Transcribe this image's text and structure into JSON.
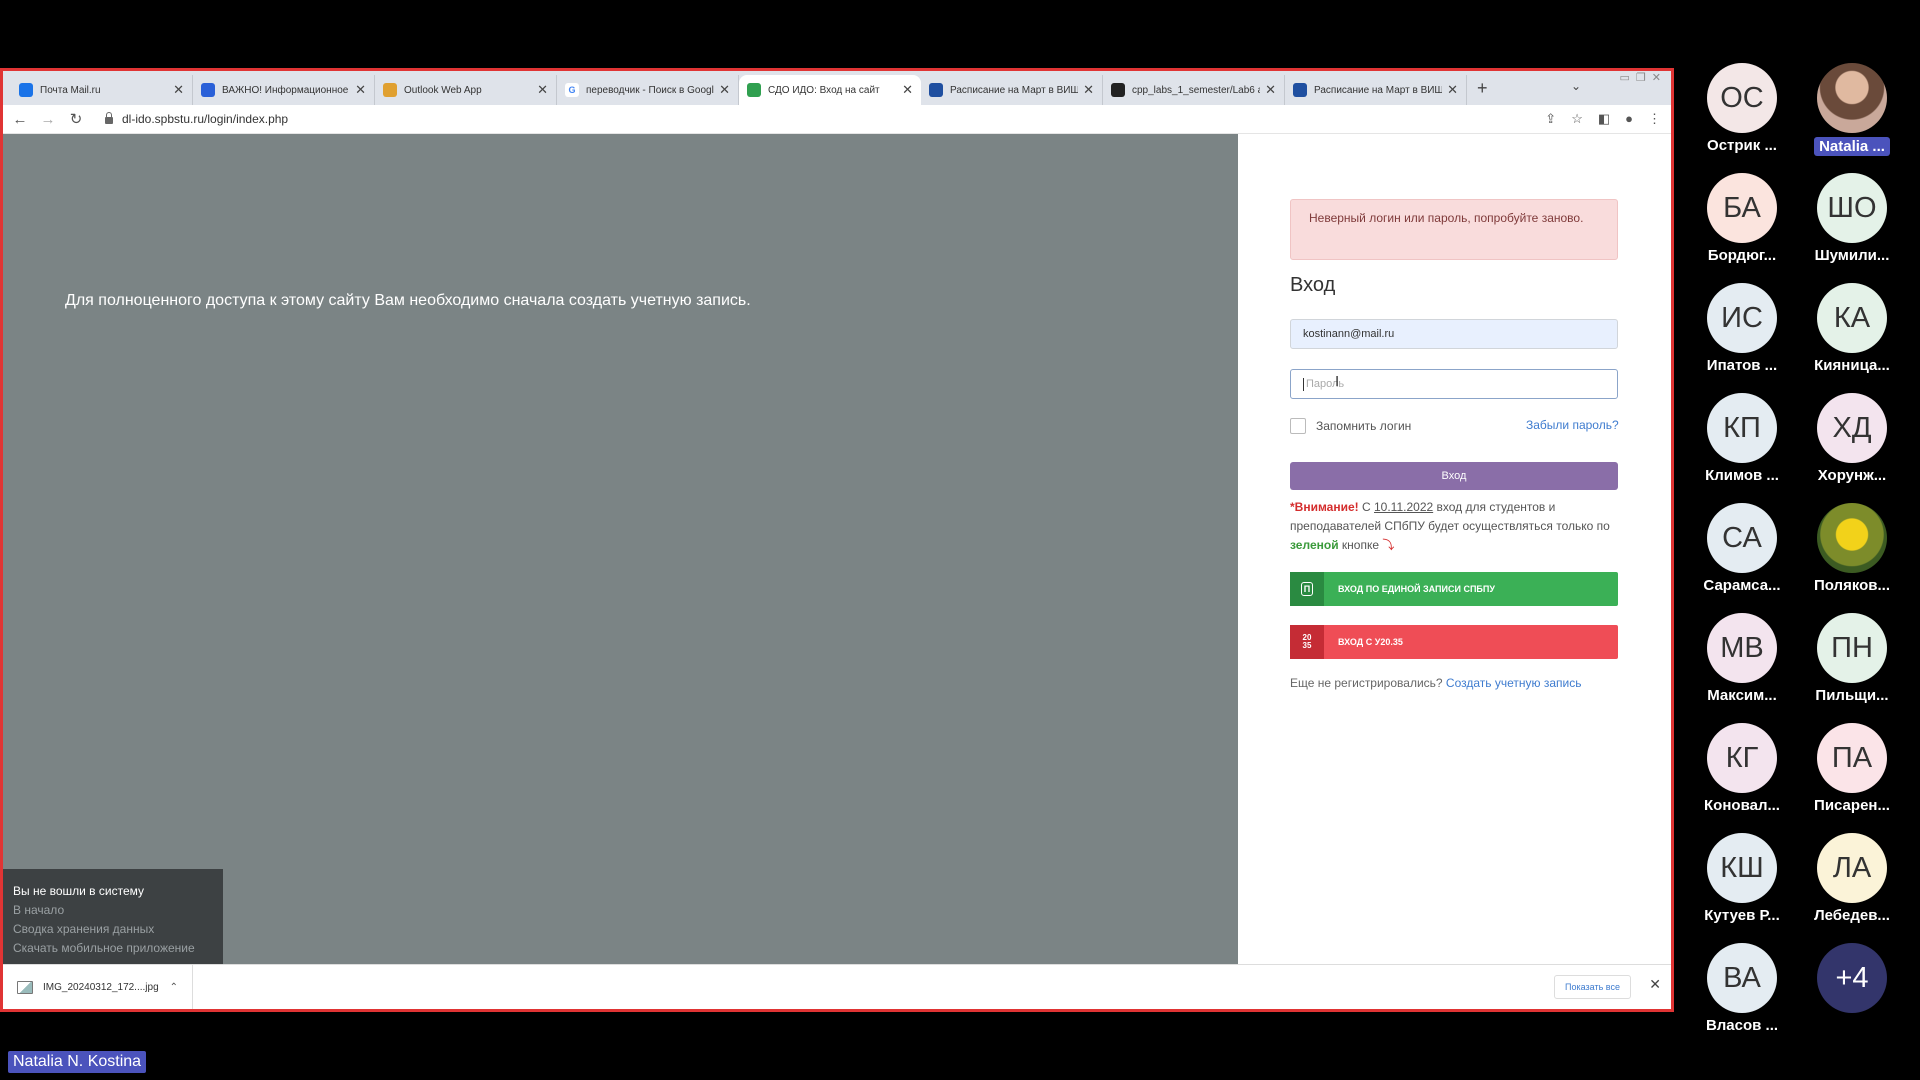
{
  "browser": {
    "tabs": [
      {
        "title": "Почта Mail.ru",
        "icon": "mail-icon",
        "color": "#1a73e8"
      },
      {
        "title": "ВАЖНО! Информационное с",
        "icon": "document-icon",
        "color": "#2a60d8"
      },
      {
        "title": "Outlook Web App",
        "icon": "outlook-icon",
        "color": "#e0a030"
      },
      {
        "title": "переводчик - Поиск в Google",
        "icon": "google-icon",
        "color": "#ffffff"
      },
      {
        "title": "СДО ИДО: Вход на сайт",
        "icon": "sdo-icon",
        "color": "#30a050",
        "active": true
      },
      {
        "title": "Расписание на Март в ВИШ",
        "icon": "polytech-icon",
        "color": "#1f4fa0"
      },
      {
        "title": "cpp_labs_1_semester/Lab6 at",
        "icon": "github-icon",
        "color": "#222222"
      },
      {
        "title": "Расписание на Март в ВИШ",
        "icon": "polytech-icon",
        "color": "#1f4fa0"
      }
    ],
    "url": "dl-ido.spbstu.ru/login/index.php"
  },
  "left": {
    "message": "Для полноценного доступа к этому сайту Вам необходимо сначала создать учетную запись.",
    "footer": {
      "status": "Вы не вошли в систему",
      "links": [
        "В начало",
        "Сводка хранения данных",
        "Скачать мобильное приложение"
      ]
    }
  },
  "login": {
    "error": "Неверный логин или пароль, попробуйте заново.",
    "heading": "Вход",
    "username_value": "kostinann@mail.ru",
    "password_placeholder": "Пароль",
    "remember_label": "Запомнить логин",
    "forgot_label": "Забыли пароль?",
    "submit_label": "Вход",
    "warning": {
      "prefix": "*Внимание!",
      "c": " С ",
      "date": "10.11.2022",
      "text1": " вход для студентов и преподавателей СПбПУ будет осуществляться только по ",
      "green_word": "зеленой",
      "text2": " кнопке ",
      "arrow": "⤵"
    },
    "sso_label": "ВХОД ПО ЕДИНОЙ ЗАПИСИ СПБПУ",
    "sso_icon_text": "П",
    "u2035_label": "ВХОД С У20.35",
    "u2035_icon_top": "20",
    "u2035_icon_bottom": "35",
    "register_question": "Еще не регистрировались?",
    "register_link": "Создать учетную запись"
  },
  "downloads": {
    "file": "IMG_20240312_172....jpg",
    "show_all": "Показать все"
  },
  "participants": [
    {
      "initials": "ОС",
      "name": "Острик ...",
      "bg": "#f3e7e7"
    },
    {
      "initials": "",
      "name": "Natalia ...",
      "bg": "photo",
      "highlight": true
    },
    {
      "initials": "БА",
      "name": "Бордюг...",
      "bg": "#fbe4de"
    },
    {
      "initials": "ШО",
      "name": "Шумили...",
      "bg": "#e4f2e8"
    },
    {
      "initials": "ИС",
      "name": "Ипатов ...",
      "bg": "#e4ecf2"
    },
    {
      "initials": "КА",
      "name": "Кияница...",
      "bg": "#e4f2e8"
    },
    {
      "initials": "КП",
      "name": "Климов ...",
      "bg": "#e4ecf2"
    },
    {
      "initials": "ХД",
      "name": "Хорунж...",
      "bg": "#f3e4ee"
    },
    {
      "initials": "СА",
      "name": "Сарамса...",
      "bg": "#e4ecf2"
    },
    {
      "initials": "",
      "name": "Поляков...",
      "bg": "flower"
    },
    {
      "initials": "МВ",
      "name": "Максим...",
      "bg": "#f3e4ee"
    },
    {
      "initials": "ПН",
      "name": "Пильщи...",
      "bg": "#e4f2e8"
    },
    {
      "initials": "КГ",
      "name": "Коновал...",
      "bg": "#f3e4ee"
    },
    {
      "initials": "ПА",
      "name": "Писарен...",
      "bg": "#fbe4e8"
    },
    {
      "initials": "КШ",
      "name": "Кутуев Р...",
      "bg": "#e4ecf2"
    },
    {
      "initials": "ЛА",
      "name": "Лебедев...",
      "bg": "#fbf3d8"
    },
    {
      "initials": "ВА",
      "name": "Власов ...",
      "bg": "#e4ecf2"
    },
    {
      "initials": "+4",
      "name": "",
      "bg": "#33356b"
    }
  ],
  "presenter_name": "Natalia N. Kostina"
}
